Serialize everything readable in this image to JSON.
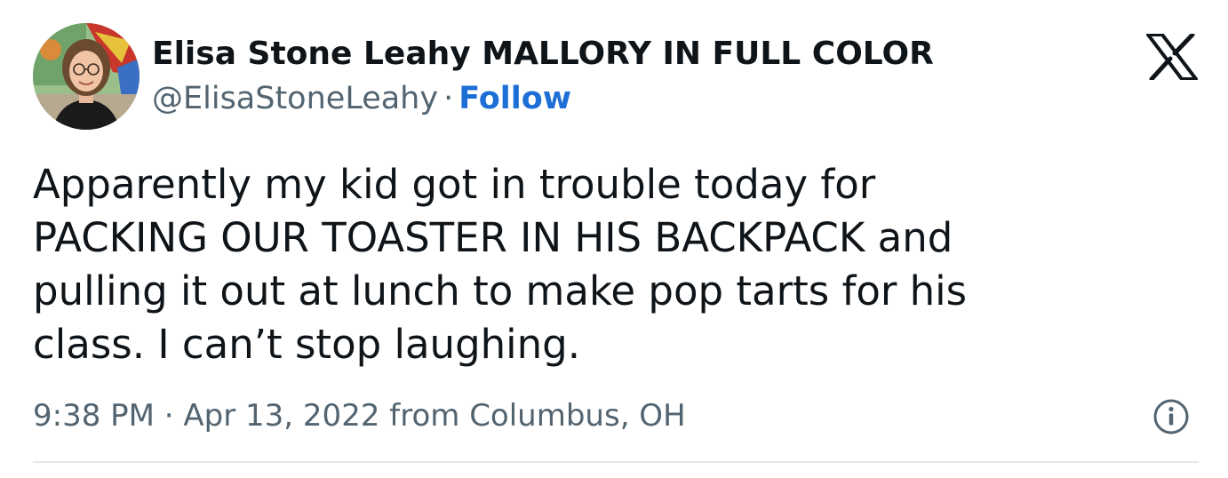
{
  "author": {
    "display_name": "Elisa Stone Leahy MALLORY IN FULL COLOR",
    "handle": "@ElisaStoneLeahy",
    "separator": "·",
    "follow_label": "Follow"
  },
  "tweet": {
    "text": "Apparently my kid got in trouble today for\nPACKING OUR TOASTER IN HIS BACKPACK and\npulling it out at lunch to make pop tarts for his\nclass. I can’t stop laughing."
  },
  "meta": {
    "timestamp": "9:38 PM · Apr 13, 2022 from Columbus, OH"
  },
  "icons": {
    "brand": "x-logo-icon",
    "info": "info-icon"
  },
  "colors": {
    "text": "#0f1419",
    "secondary": "#536471",
    "link": "#1d6fd6",
    "divider": "#e1e8ed"
  }
}
